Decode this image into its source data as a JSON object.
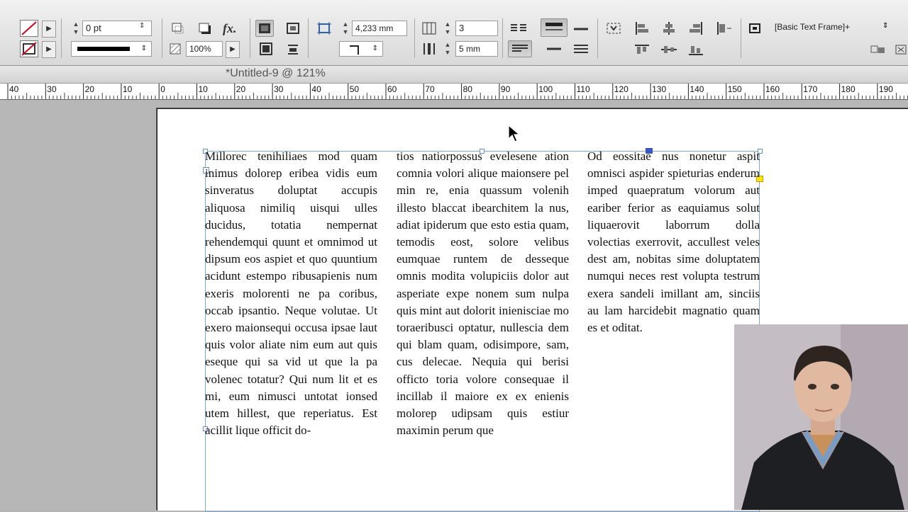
{
  "control_panel": {
    "stroke_weight": "0 pt",
    "fx_label": "fx.",
    "scale": "100%",
    "gutter": "4,233 mm",
    "columns": "3",
    "column_gutter": "5 mm",
    "object_style": "[Basic Text Frame]+"
  },
  "document": {
    "title": "*Untitled-9 @ 121%"
  },
  "ruler": {
    "labels": [
      "40",
      "30",
      "20",
      "10",
      "0",
      "10",
      "20",
      "30",
      "40",
      "50",
      "60",
      "70",
      "80",
      "90",
      "100",
      "110",
      "120",
      "130",
      "140",
      "150",
      "160",
      "170",
      "180",
      "190"
    ]
  },
  "text_columns": [
    "Millorec tenihiliaes mod quam inimus dolorep eribea vidis eum sinveratus doluptat accupis aliquosa nimiliq uisqui ulles ducidus, totatia nempernat rehendemqui quunt et omnimod ut dipsum eos aspiet et quo quuntium acidunt estempo ribusapienis num exeris molorenti ne pa coribus, occab ipsantio. Neque volutae. Ut exero maionsequi occusa ipsae laut quis volor aliate nim eum aut quis eseque qui sa vid ut que la pa volenec totatur? Qui num lit et es mi, eum nimusci untotat ionsed utem hillest, que reperiatus. Est acillit lique officit do-",
    "tios natiorpossus evelesene ation comnia volori alique maionsere pel min re, enia quassum volenih illesto blaccat ibearchitem la nus, adiat ipiderum que esto estia quam, temodis eost, solore velibus eumquae runtem de desseque omnis modita volupiciis dolor aut asperiate expe nonem sum nulpa quis mint aut dolorit inienisciae mo toraeribusci optatur, nullescia dem qui blam quam, odisimpore, sam, cus delecae. Nequia qui berisi officto toria volore consequae il incillab il maiore ex ex enienis molorep udipsam quis estiur maximin perum que",
    "Od eossitae nus nonetur aspit omnisci aspider spieturias enderum imped quaepratum volorum aut eariber ferior as eaquiamus solut liquaerovit laborrum dolla volectias exerrovit, accullest veles dest am, nobitas sime doluptatem numqui neces rest volupta testrum exera sandeli imillant am, sinciis au lam harcidebit magnatio quam es et oditat."
  ],
  "colors": {
    "frame": "#7fa6d9",
    "selection_handle": "#3a55c8",
    "overset_port": "#ffe600"
  }
}
